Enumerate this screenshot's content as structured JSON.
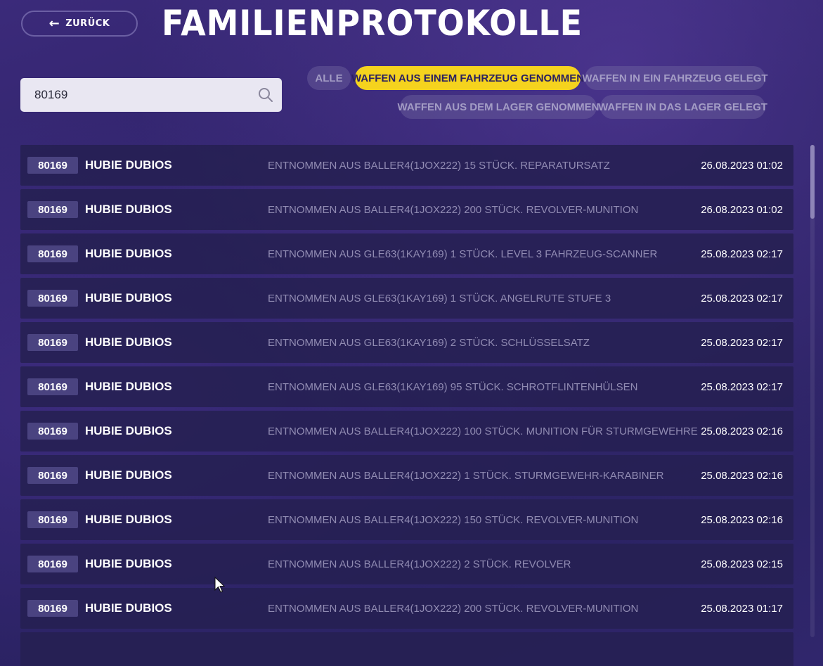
{
  "header": {
    "back_label": "ZURÜCK",
    "title": "FAMILIENPROTOKOLLE"
  },
  "search": {
    "value": "80169",
    "placeholder": ""
  },
  "filters": [
    {
      "label": "ALLE",
      "active": false
    },
    {
      "label": "WAFFEN AUS EINEM FAHRZEUG GENOMMEN",
      "active": true
    },
    {
      "label": "WAFFEN IN EIN FAHRZEUG GELEGT",
      "active": false
    },
    {
      "label": "WAFFEN AUS DEM LAGER GENOMMEN",
      "active": false
    },
    {
      "label": "WAFFEN IN DAS LAGER GELEGT",
      "active": false
    }
  ],
  "colors": {
    "accent": "#f5d31e",
    "background": "#2c2266"
  },
  "logs": [
    {
      "id": "80169",
      "name": "HUBIE DUBIOS",
      "description": "ENTNOMMEN AUS BALLER4(1JOX222) 15 STÜCK. REPARATURSATZ",
      "date": "26.08.2023 01:02"
    },
    {
      "id": "80169",
      "name": "HUBIE DUBIOS",
      "description": "ENTNOMMEN AUS BALLER4(1JOX222) 200 STÜCK. REVOLVER-MUNITION",
      "date": "26.08.2023 01:02"
    },
    {
      "id": "80169",
      "name": "HUBIE DUBIOS",
      "description": "ENTNOMMEN AUS GLE63(1KAY169) 1 STÜCK. LEVEL 3 FAHRZEUG-SCANNER",
      "date": "25.08.2023 02:17"
    },
    {
      "id": "80169",
      "name": "HUBIE DUBIOS",
      "description": "ENTNOMMEN AUS GLE63(1KAY169) 1 STÜCK. ANGELRUTE STUFE 3",
      "date": "25.08.2023 02:17"
    },
    {
      "id": "80169",
      "name": "HUBIE DUBIOS",
      "description": "ENTNOMMEN AUS GLE63(1KAY169) 2 STÜCK. SCHLÜSSELSATZ",
      "date": "25.08.2023 02:17"
    },
    {
      "id": "80169",
      "name": "HUBIE DUBIOS",
      "description": "ENTNOMMEN AUS GLE63(1KAY169) 95 STÜCK. SCHROTFLINTENHÜLSEN",
      "date": "25.08.2023 02:17"
    },
    {
      "id": "80169",
      "name": "HUBIE DUBIOS",
      "description": "ENTNOMMEN AUS BALLER4(1JOX222) 100 STÜCK. MUNITION FÜR STURMGEWEHRE",
      "date": "25.08.2023 02:16"
    },
    {
      "id": "80169",
      "name": "HUBIE DUBIOS",
      "description": "ENTNOMMEN AUS BALLER4(1JOX222) 1 STÜCK. STURMGEWEHR-KARABINER",
      "date": "25.08.2023 02:16"
    },
    {
      "id": "80169",
      "name": "HUBIE DUBIOS",
      "description": "ENTNOMMEN AUS BALLER4(1JOX222) 150 STÜCK. REVOLVER-MUNITION",
      "date": "25.08.2023 02:16"
    },
    {
      "id": "80169",
      "name": "HUBIE DUBIOS",
      "description": "ENTNOMMEN AUS BALLER4(1JOX222) 2 STÜCK. REVOLVER",
      "date": "25.08.2023 02:15"
    },
    {
      "id": "80169",
      "name": "HUBIE DUBIOS",
      "description": "ENTNOMMEN AUS BALLER4(1JOX222) 200 STÜCK. REVOLVER-MUNITION",
      "date": "25.08.2023 01:17"
    }
  ]
}
